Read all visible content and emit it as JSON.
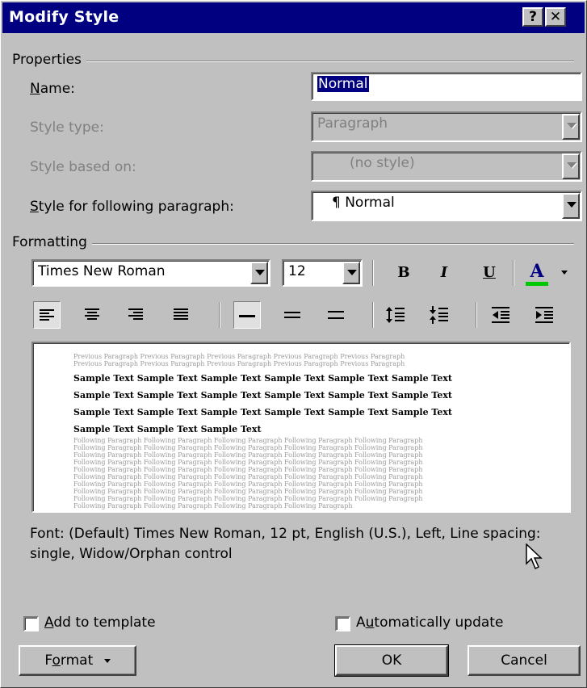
{
  "window": {
    "title": "Modify Style",
    "help_glyph": "?",
    "close_glyph": "✕"
  },
  "properties": {
    "group_label": "Properties",
    "name": {
      "label": "Name:",
      "value": "Normal"
    },
    "style_type": {
      "label": "Style type:",
      "value": "Paragraph",
      "enabled": false
    },
    "based_on": {
      "label": "Style based on:",
      "value": "(no style)",
      "enabled": false
    },
    "following": {
      "label": "Style for following paragraph:",
      "value": "¶ Normal"
    }
  },
  "formatting": {
    "group_label": "Formatting",
    "font": "Times New Roman",
    "size": "12",
    "bold": "B",
    "italic": "I",
    "underline": "U",
    "font_color_glyph": "A",
    "font_color": "#00c800"
  },
  "preview": {
    "previous_lines": [
      "Previous Paragraph Previous Paragraph Previous Paragraph Previous Paragraph Previous Paragraph",
      "Previous Paragraph Previous Paragraph Previous Paragraph Previous Paragraph Previous Paragraph"
    ],
    "sample_lines": [
      "Sample Text Sample Text Sample Text Sample Text Sample Text Sample Text",
      "Sample Text Sample Text Sample Text Sample Text Sample Text Sample Text",
      "Sample Text Sample Text Sample Text Sample Text Sample Text Sample Text",
      "Sample Text Sample Text Sample Text"
    ],
    "following_lines": [
      "Following Paragraph Following Paragraph Following Paragraph Following Paragraph Following Paragraph",
      "Following Paragraph Following Paragraph Following Paragraph Following Paragraph Following Paragraph",
      "Following Paragraph Following Paragraph Following Paragraph Following Paragraph Following Paragraph",
      "Following Paragraph Following Paragraph Following Paragraph Following Paragraph Following Paragraph",
      "Following Paragraph Following Paragraph Following Paragraph Following Paragraph Following Paragraph",
      "Following Paragraph Following Paragraph Following Paragraph Following Paragraph Following Paragraph",
      "Following Paragraph Following Paragraph Following Paragraph Following Paragraph Following Paragraph",
      "Following Paragraph Following Paragraph Following Paragraph Following Paragraph Following Paragraph",
      "Following Paragraph Following Paragraph Following Paragraph Following Paragraph Following Paragraph",
      "Following Paragraph Following Paragraph Following Paragraph Following Paragraph"
    ]
  },
  "description": "Font: (Default) Times New Roman, 12 pt, English (U.S.), Left, Line spacing:  single, Widow/Orphan control",
  "options": {
    "add_to_template": {
      "label": "Add to template",
      "checked": false
    },
    "auto_update": {
      "label": "Automatically update",
      "checked": false
    }
  },
  "buttons": {
    "format": "Format",
    "ok": "OK",
    "cancel": "Cancel"
  }
}
